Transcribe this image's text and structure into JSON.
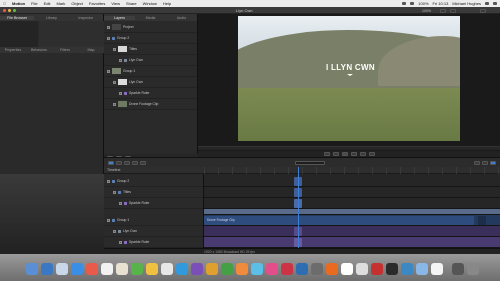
{
  "menubar": {
    "apple": "",
    "app_name": "Motion",
    "items": [
      "File",
      "Edit",
      "Mark",
      "Object",
      "Favorites",
      "View",
      "Share",
      "Window",
      "Help"
    ],
    "status_pct": "100%",
    "clock": "Fri 10:13",
    "user": "Michael Hughes"
  },
  "window_title": "Llyn Cwn",
  "browser_tabs": [
    "File Browser",
    "Library",
    "Inspector"
  ],
  "browser_active_tab": 0,
  "browser_bottom": [
    "Properties",
    "Behaviors",
    "Filters",
    "Map"
  ],
  "layers_tabs": [
    "Layers",
    "Media",
    "Audio"
  ],
  "layers": [
    {
      "label": "Project"
    },
    {
      "label": "Group 2"
    },
    {
      "label": "Titles"
    },
    {
      "label": "Llyn Cwn"
    },
    {
      "label": "Group 1"
    },
    {
      "label": "Llyn Cwn"
    },
    {
      "label": "Sparkle Ruler"
    },
    {
      "label": "Drone Footage Clip"
    }
  ],
  "canvas": {
    "overlay_title": "I LLYN CWN",
    "zoom": "100%"
  },
  "timeline_label": "Timeline",
  "timeline_tracks": [
    {
      "label": "Group 2"
    },
    {
      "label": "Titles"
    },
    {
      "label": "Sparkle Ruler"
    },
    {
      "label": "Group 1"
    },
    {
      "label": "Llyn Cwn"
    },
    {
      "label": "Sparkle Ruler"
    }
  ],
  "timeline_clip_label": "Drone Footage Clip",
  "status_bar": "1920 x 1080 Broadcast HD 25 fps",
  "dock": {
    "colors": [
      "#5a8fd6",
      "#3b78c4",
      "#c9d8e8",
      "#3a8ee6",
      "#e85a4a",
      "#f2f2f2",
      "#e8e0d0",
      "#58b34a",
      "#f0c040",
      "#e7e7e7",
      "#3399dd",
      "#7a4fb8",
      "#e0a030",
      "#45a045",
      "#f08a3c",
      "#5bbfe8",
      "#e24d8a",
      "#cc3344",
      "#2f6db3",
      "#6c6c6c",
      "#ea6b1f",
      "#ffffff",
      "#dddddd",
      "#c53030",
      "#2b2b2b",
      "#3b88c3",
      "#8ab8e6",
      "#f4f4f4",
      "#555555",
      "#888888"
    ]
  },
  "colors": {
    "accent": "#3d7fd6",
    "playhead": "#3d7fd6"
  }
}
